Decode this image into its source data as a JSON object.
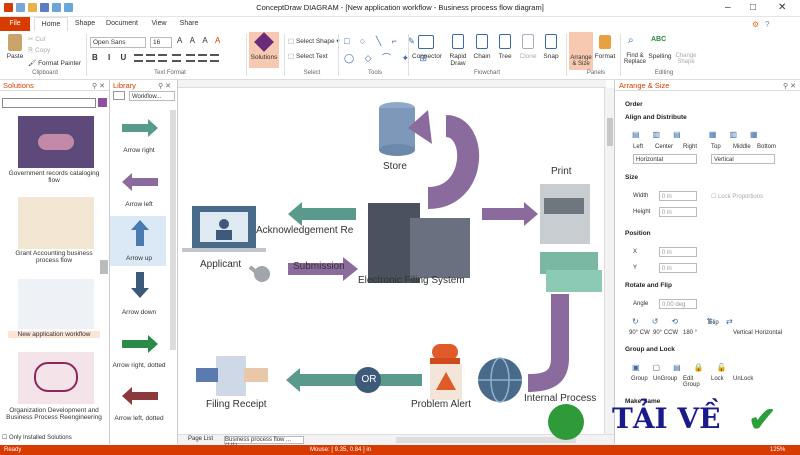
{
  "window": {
    "title": "ConceptDraw DIAGRAM - [New application workflow - Business process flow diagram]"
  },
  "tabs": [
    "File",
    "Home",
    "Shape",
    "Document",
    "View",
    "Share"
  ],
  "ribbon": {
    "paste": "Paste",
    "cut": "Cut",
    "copy": "Copy",
    "format_painter": "Format Painter",
    "clipboard": "Clipboard",
    "font": "Open Sans",
    "size": "16",
    "text_format": "Text Format",
    "solutions": "Solutions",
    "select_shape": "Select Shape",
    "select_text": "Select Text",
    "select": "Select",
    "tools": "Tools",
    "connector": "Connector",
    "rapid_draw": "Rapid Draw",
    "chain": "Chain",
    "tree": "Tree",
    "clone": "Clone",
    "snap": "Snap",
    "flowchart": "Flowchart",
    "arrange_size": "Arrange & Size",
    "format": "Format",
    "panels": "Panels",
    "find_replace": "Find & Replace",
    "spelling": "Spelling",
    "change_shape": "Change Shape",
    "editing": "Editing"
  },
  "solutions": {
    "title": "Solutions",
    "items": [
      "Government records cataloging flow",
      "Grant Accounting business process flow",
      "New application workflow",
      "Organization Development and Business Process Reengineering"
    ],
    "only_installed": "Only Installed Solutions"
  },
  "library": {
    "title": "Library",
    "dropdown": "Workflow...",
    "items": [
      "Arrow right",
      "Arrow left",
      "Arrow up",
      "Arrow down",
      "Arrow right, dotted",
      "Arrow left, dotted"
    ]
  },
  "diagram": {
    "store": "Store",
    "print": "Print",
    "applicant": "Applicant",
    "acknowledgement": "Acknowledgement Re",
    "submission": "Submission",
    "efs": "Electronic Filing System",
    "filing_receipt": "Filing Receipt",
    "or": "OR",
    "problem_alert": "Problem Alert",
    "internal_process": "Internal Process"
  },
  "arrange": {
    "title": "Arrange & Size",
    "order": "Order",
    "align": "Align and Distribute",
    "left": "Left",
    "center": "Center",
    "right": "Right",
    "top": "Top",
    "middle": "Middle",
    "bottom": "Bottom",
    "horizontal": "Horizontal",
    "vertical": "Vertical",
    "size": "Size",
    "width": "Width",
    "height": "Height",
    "w_val": "0 in",
    "h_val": "0 in",
    "lock": "Lock Proportions",
    "position": "Position",
    "x": "X",
    "y": "Y",
    "x_val": "0 in",
    "y_val": "0 in",
    "rotate": "Rotate and Flip",
    "angle": "Angle",
    "angle_val": "0.00 deg",
    "cw": "90° CW",
    "ccw": "90° CCW",
    "r180": "180 °",
    "flip": "Flip",
    "fv": "Vertical",
    "fh": "Horizontal",
    "group_lock": "Group and Lock",
    "group": "Group",
    "ungroup": "UnGroup",
    "edit_group": "Edit Group",
    "lockb": "Lock",
    "unlock": "UnLock",
    "make_same": "Make Same"
  },
  "pagebar": {
    "page_list": "Page List",
    "page": "Business process flow ... (1/1)"
  },
  "status": {
    "ready": "Ready",
    "mouse": "Mouse: [ 9.35, 0.84 ] in",
    "zoom": "125%"
  },
  "watermark": "TẢI VỀ",
  "colors": {
    "accent": "#d83b01",
    "teal": "#5a9a8c",
    "purple": "#8b6b9e",
    "navy": "#3e5a7a"
  }
}
